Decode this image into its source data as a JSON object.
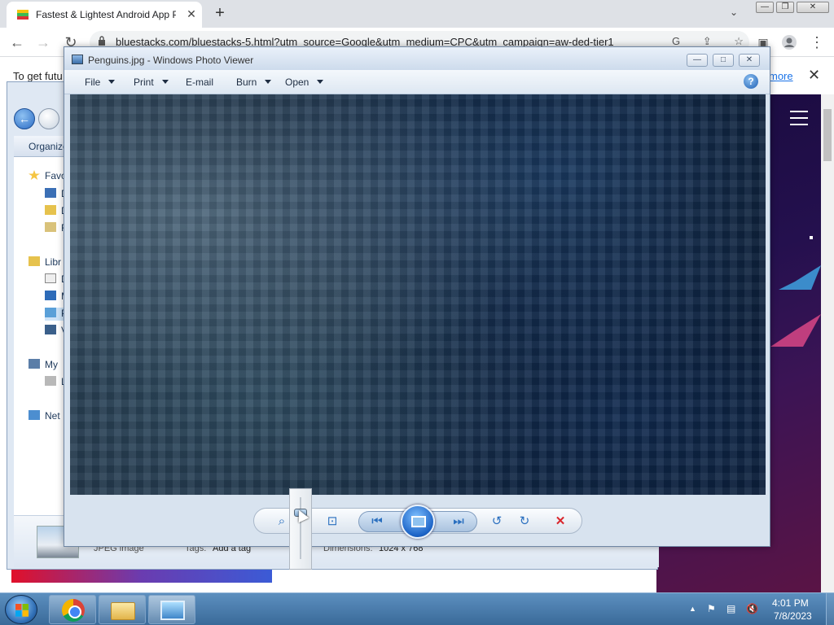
{
  "browser": {
    "tab_title": "Fastest & Lightest Android App Player",
    "tab_close": "✕",
    "new_tab": "+",
    "tab_list": "⌄",
    "url": "bluestacks.com/bluestacks-5.html?utm_source=Google&utm_medium=CPC&utm_campaign=aw-ded-tier1",
    "info_text": "To get futu",
    "info_more": "more",
    "info_close": "✕",
    "nav_back": "←",
    "nav_forward": "→",
    "nav_reload": "↻",
    "omni_icons": "G ⇪ ☆"
  },
  "explorer": {
    "organize": "Organize",
    "tree": [
      "Favo",
      "De",
      "Do",
      "Re",
      "Libr",
      "Do",
      "Mu",
      "Pi",
      "Vi",
      "My",
      "Lo",
      "Net"
    ],
    "detail_type": "JPEG image",
    "detail_tags_label": "Tags:",
    "detail_tags_value": "Add a tag",
    "detail_dimensions_label": "Dimensions:",
    "detail_dimensions_value": "1024 x 768"
  },
  "viewer": {
    "title": "Penguins.jpg - Windows Photo Viewer",
    "menu": {
      "file": "File",
      "print": "Print",
      "email": "E-mail",
      "burn": "Burn",
      "open": "Open"
    },
    "help": "?",
    "controls": {
      "zoom": "⌕",
      "actual_size": "⊡",
      "previous": "⏮",
      "next": "⏭",
      "rotate_ccw": "↺",
      "rotate_cw": "↻",
      "delete": "✕"
    }
  },
  "taskbar": {
    "clock_time": "4:01 PM",
    "clock_date": "7/8/2023",
    "tray_chevron": "▲"
  },
  "colors": {
    "viewer_frame": "#d8e3ef",
    "taskbar": "#3a6a99",
    "delete_red": "#d9262c",
    "link_blue": "#1a73e8"
  }
}
